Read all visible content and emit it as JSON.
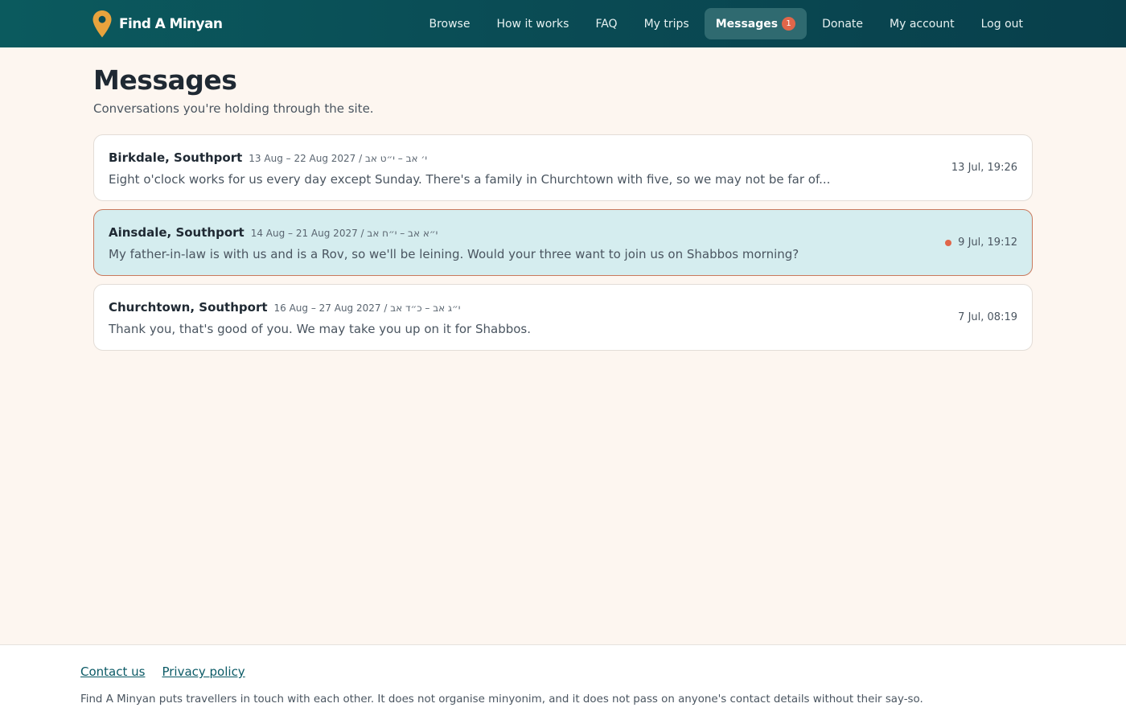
{
  "header": {
    "brand_name": "Find A Minyan",
    "brand_icon": "map-pin-icon",
    "nav": {
      "browse": "Browse",
      "how_it_works": "How it works",
      "faq": "FAQ",
      "my_trips": "My trips",
      "messages": "Messages",
      "messages_badge": "1",
      "donate": "Donate",
      "my_account": "My account",
      "log_out": "Log out"
    },
    "active_nav": "messages"
  },
  "page": {
    "title": "Messages",
    "subtitle": "Conversations you're holding through the site."
  },
  "conversations": [
    {
      "place": "Birkdale, Southport",
      "dates": "13 Aug – 22 Aug 2027 / י׳ אב – י״ט אב",
      "preview": "Eight o'clock works for us every day except Sunday. There's a family in Churchtown with five, so we may not be far of...",
      "time": "13 Jul, 19:26",
      "unread": false
    },
    {
      "place": "Ainsdale, Southport",
      "dates": "14 Aug – 21 Aug 2027 / י״א אב – י״ח אב",
      "preview": "My father-in-law is with us and is a Rov, so we'll be leining. Would your three want to join us on Shabbos morning?",
      "time": "9 Jul, 19:12",
      "unread": true
    },
    {
      "place": "Churchtown, Southport",
      "dates": "16 Aug – 27 Aug 2027 / י״ג אב – כ״ד אב",
      "preview": "Thank you, that's good of you. We may take you up on it for Shabbos.",
      "time": "7 Jul, 08:19",
      "unread": false
    }
  ],
  "footer": {
    "contact_us": "Contact us",
    "privacy_policy": "Privacy policy",
    "note": "Find A Minyan puts travellers in touch with each other. It does not organise minyonim, and it does not pass on anyone's contact details without their say-so."
  },
  "colors": {
    "header_bg": "#0a4c55",
    "page_bg": "#fdf6f0",
    "accent_badge": "#e0664a",
    "pin": "#e8a33d",
    "unread_bg": "#d5edef",
    "unread_border": "#c9795d",
    "link": "#0b5a66"
  }
}
